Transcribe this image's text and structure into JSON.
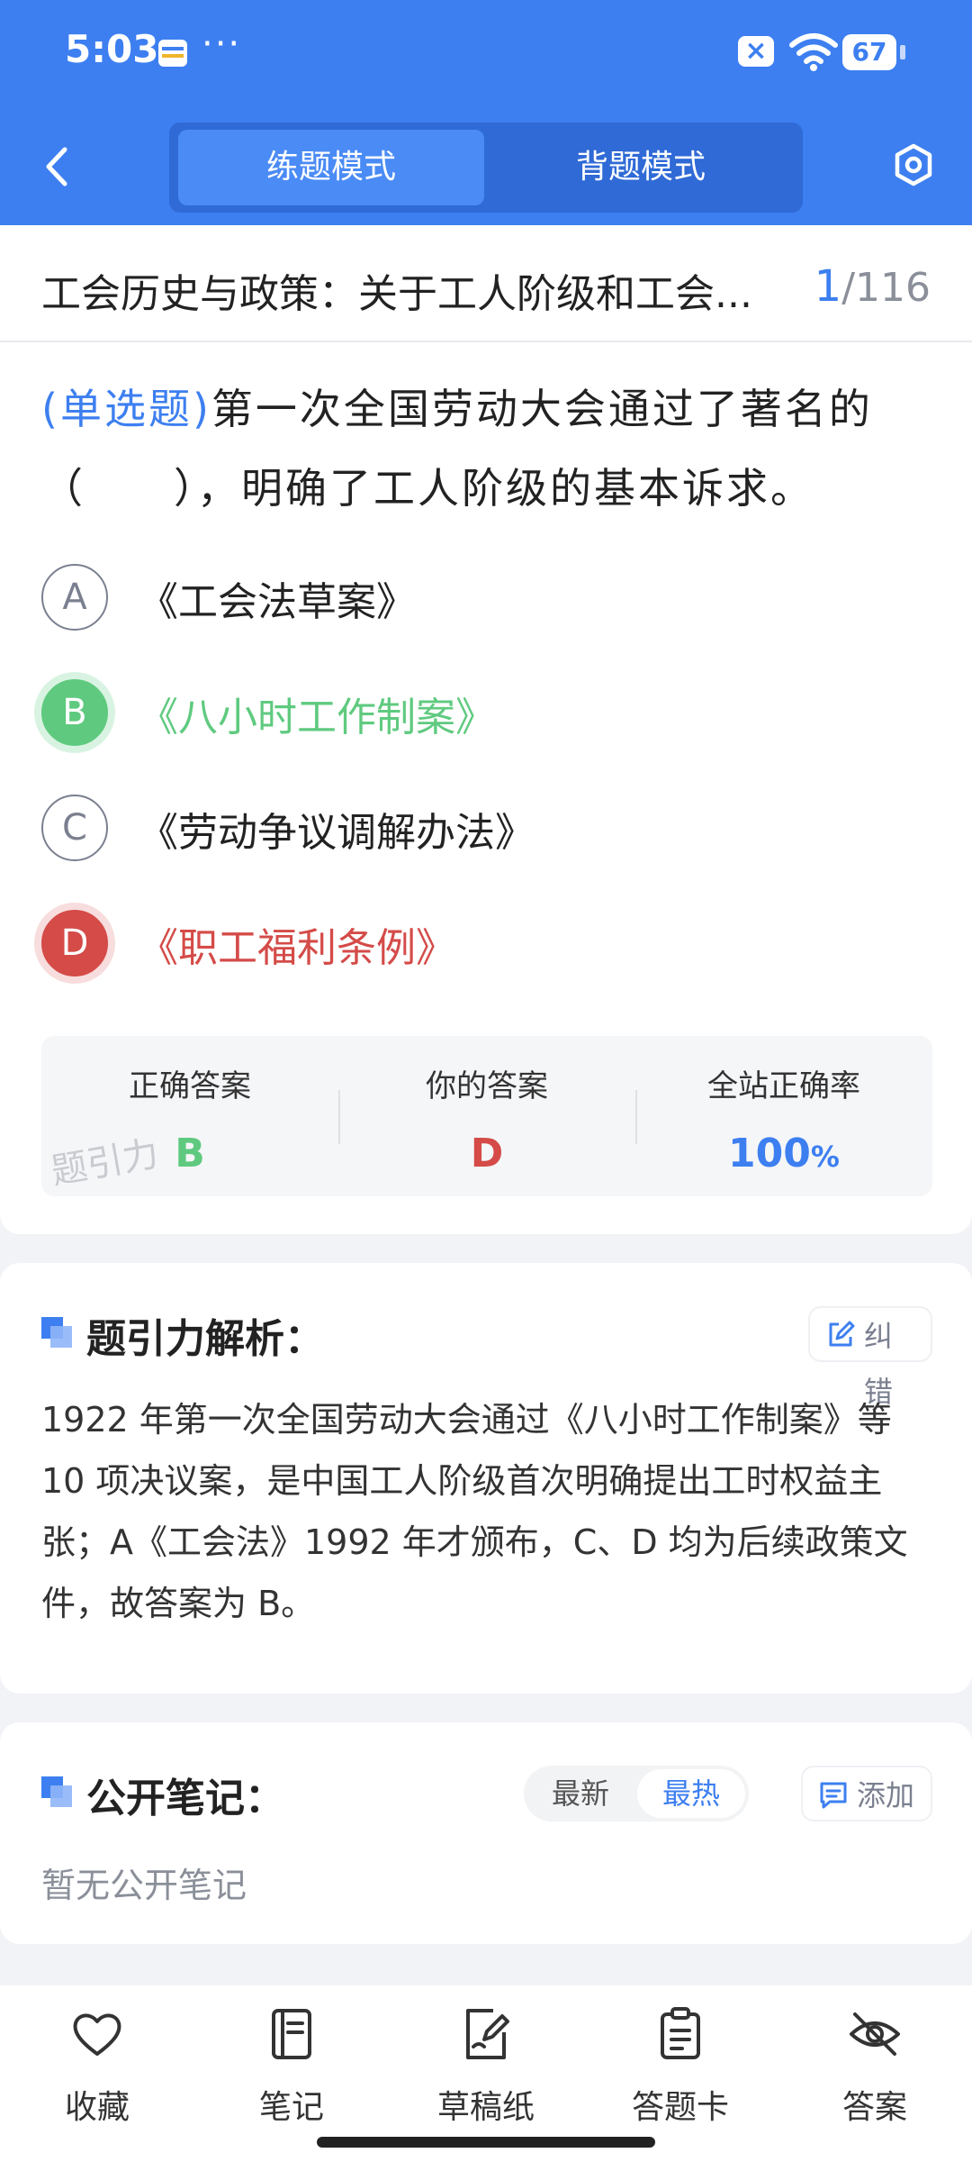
{
  "status_bar": {
    "time": "5:03",
    "more": "···",
    "battery": "67"
  },
  "header": {
    "tabs": [
      {
        "label": "练题模式",
        "active": true
      },
      {
        "label": "背题模式",
        "active": false
      }
    ]
  },
  "question_header": {
    "title": "工会历史与政策：关于工人阶级和工会...",
    "current": "1",
    "total": "/116"
  },
  "question": {
    "type_label": "(单选题)",
    "text": "第一次全国劳动大会通过了著名的（　　），明确了工人阶级的基本诉求。"
  },
  "options": [
    {
      "letter": "A",
      "text": "《工会法草案》",
      "state": "normal"
    },
    {
      "letter": "B",
      "text": "《八小时工作制案》",
      "state": "correct"
    },
    {
      "letter": "C",
      "text": "《劳动争议调解办法》",
      "state": "normal"
    },
    {
      "letter": "D",
      "text": "《职工福利条例》",
      "state": "wrong"
    }
  ],
  "answer_summary": {
    "correct_label": "正确答案",
    "correct_value": "B",
    "yours_label": "你的答案",
    "yours_value": "D",
    "rate_label": "全站正确率",
    "rate_value": "100",
    "rate_unit": "%",
    "watermark": "题引力"
  },
  "analysis": {
    "title": "题引力解析：",
    "correct_button": "纠错",
    "text": "1922 年第一次全国劳动大会通过《八小时工作制案》等 10 项决议案，是中国工人阶级首次明确提出工时权益主张；A《工会法》1992 年才颁布，C、D 均为后续政策文件，故答案为 B。"
  },
  "notes": {
    "title": "公开笔记：",
    "sort_options": [
      "最新",
      "最热"
    ],
    "active_sort": "最热",
    "add_button": "添加",
    "empty_text": "暂无公开笔记"
  },
  "bottom_nav": [
    {
      "label": "收藏",
      "icon": "heart-icon"
    },
    {
      "label": "笔记",
      "icon": "notebook-icon"
    },
    {
      "label": "草稿纸",
      "icon": "draft-icon"
    },
    {
      "label": "答题卡",
      "icon": "answer-card-icon"
    },
    {
      "label": "答案",
      "icon": "eye-off-icon"
    }
  ],
  "colors": {
    "primary": "#3d7ff0",
    "correct": "#5fca7f",
    "wrong": "#d44b48"
  }
}
